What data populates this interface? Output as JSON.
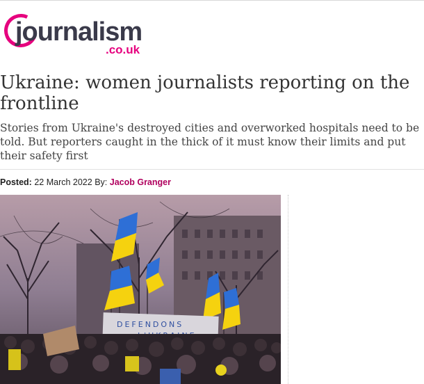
{
  "site": {
    "logo_word": "journalism",
    "logo_tld": ".co.uk",
    "brand_color": "#e6007e",
    "logo_text_color": "#3a3a4a"
  },
  "article": {
    "headline": "Ukraine: women journalists reporting on the frontline",
    "standfirst": "Stories from Ukraine's destroyed cities and overworked hospitals need to be told. But reporters caught in the thick of it must know their limits and put their safety first",
    "posted_label": "Posted:",
    "posted_date": "22 March 2022",
    "by_label": "By:",
    "author": "Jacob Granger",
    "author_color": "#b0005e"
  },
  "photo": {
    "banner_text_line1": "DEFENDONS",
    "banner_text_line2": "L'UKRAINE",
    "flag_colors": [
      "#2e6fd6",
      "#f5d20f"
    ]
  }
}
